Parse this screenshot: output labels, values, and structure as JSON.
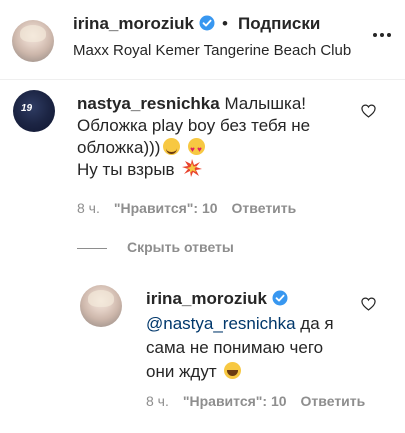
{
  "header": {
    "username": "irina_moroziuk",
    "separator": "•",
    "follow_label": "Подписки",
    "location": "Maxx Royal Kemer Tangerine Beach Club"
  },
  "comment": {
    "username": "nastya_resnichka",
    "line1": "Малышка!",
    "line2": "Обложка play boy без тебя не",
    "line3": "обложка)))",
    "line4": "Ну ты взрыв",
    "avatar_number": "19",
    "time": "8 ч.",
    "likes": "\"Нравится\": 10",
    "reply_label": "Ответить"
  },
  "replies_toggle": {
    "label": "Скрыть ответы"
  },
  "reply": {
    "username": "irina_moroziuk",
    "mention": "@nastya_resnichka",
    "line1_rest": " да я",
    "line2": "сама не понимаю чего",
    "line3": "они ждут",
    "time": "8 ч.",
    "likes": "\"Нравится\": 10",
    "reply_label": "Ответить"
  },
  "colors": {
    "text": "#262626",
    "secondary": "#8e8e8e",
    "verified": "#3897f0",
    "mention": "#00376b"
  },
  "icons": {
    "verified": "verified-badge-icon",
    "more": "more-options-icon",
    "like": "heart-outline-icon"
  }
}
